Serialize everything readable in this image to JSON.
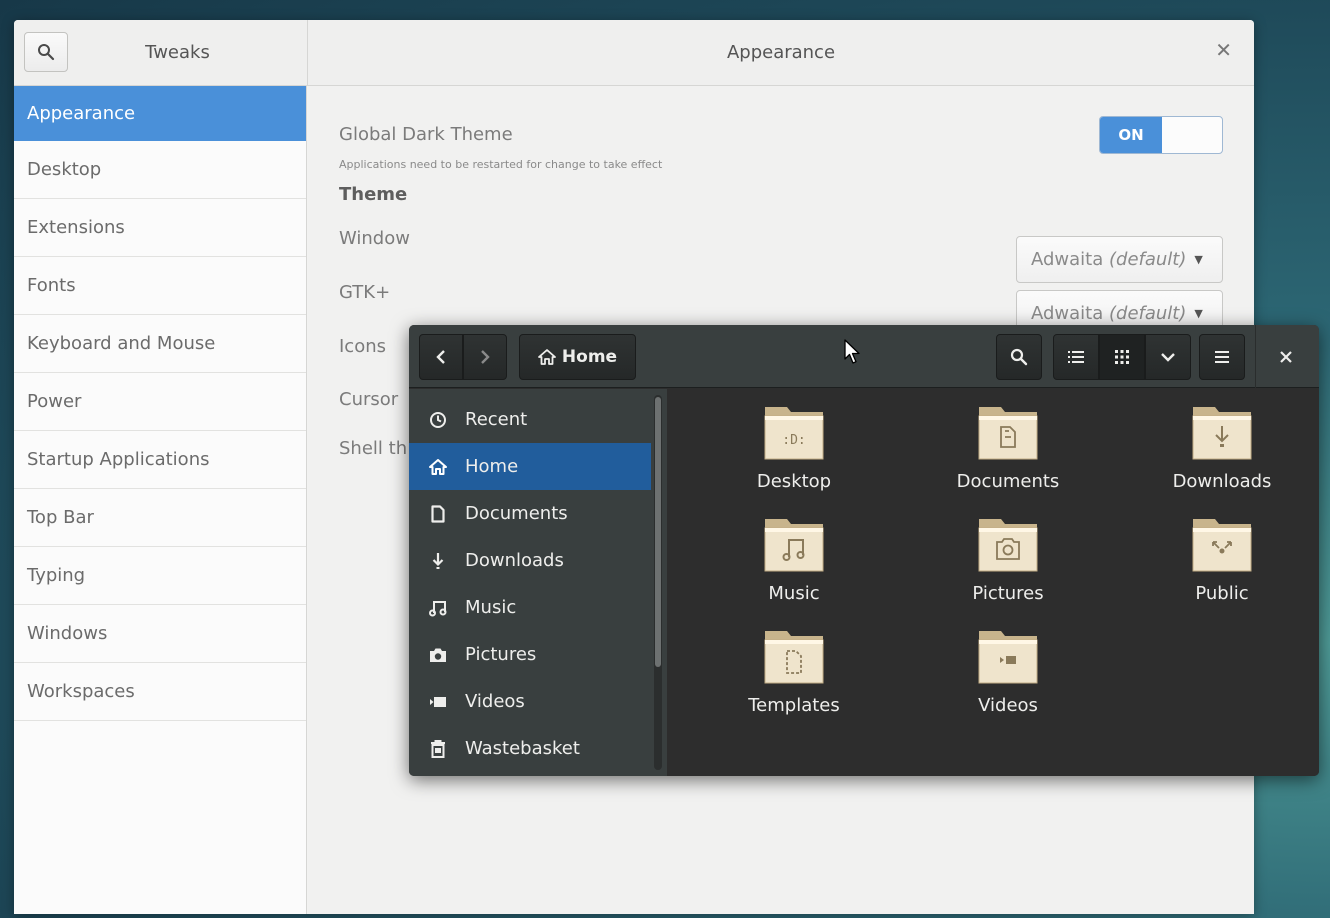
{
  "tweaks": {
    "app_title": "Tweaks",
    "page_title": "Appearance",
    "sidebar": [
      {
        "label": "Appearance",
        "active": true
      },
      {
        "label": "Desktop"
      },
      {
        "label": "Extensions"
      },
      {
        "label": "Fonts"
      },
      {
        "label": "Keyboard and Mouse"
      },
      {
        "label": "Power"
      },
      {
        "label": "Startup Applications"
      },
      {
        "label": "Top Bar"
      },
      {
        "label": "Typing"
      },
      {
        "label": "Windows"
      },
      {
        "label": "Workspaces"
      }
    ],
    "content": {
      "dark_theme_label": "Global Dark Theme",
      "dark_theme_note": "Applications need to be restarted for change to take effect",
      "dark_theme_switch": "ON",
      "theme_heading": "Theme",
      "window_label": "Window",
      "window_value": "Adwaita",
      "window_default": "(default)",
      "gtk_label": "GTK+",
      "gtk_value": "Adwaita",
      "gtk_default": "(default)",
      "icons_label": "Icons",
      "cursor_label": "Cursor",
      "shell_label": "Shell th"
    },
    "colors": {
      "accent": "#4a90d9"
    }
  },
  "files": {
    "path_label": "Home",
    "places": [
      {
        "label": "Recent",
        "icon": "clock-icon"
      },
      {
        "label": "Home",
        "icon": "home-icon",
        "active": true
      },
      {
        "label": "Documents",
        "icon": "document-icon"
      },
      {
        "label": "Downloads",
        "icon": "download-icon"
      },
      {
        "label": "Music",
        "icon": "music-icon"
      },
      {
        "label": "Pictures",
        "icon": "camera-icon"
      },
      {
        "label": "Videos",
        "icon": "video-icon"
      },
      {
        "label": "Wastebasket",
        "icon": "trash-icon"
      }
    ],
    "folders": [
      {
        "label": "Desktop",
        "emblem": "desktop"
      },
      {
        "label": "Documents",
        "emblem": "documents"
      },
      {
        "label": "Downloads",
        "emblem": "downloads"
      },
      {
        "label": "Music",
        "emblem": "music"
      },
      {
        "label": "Pictures",
        "emblem": "pictures"
      },
      {
        "label": "Public",
        "emblem": "public"
      },
      {
        "label": "Templates",
        "emblem": "templates"
      },
      {
        "label": "Videos",
        "emblem": "videos"
      }
    ],
    "colors": {
      "selection": "#215d9c"
    }
  }
}
